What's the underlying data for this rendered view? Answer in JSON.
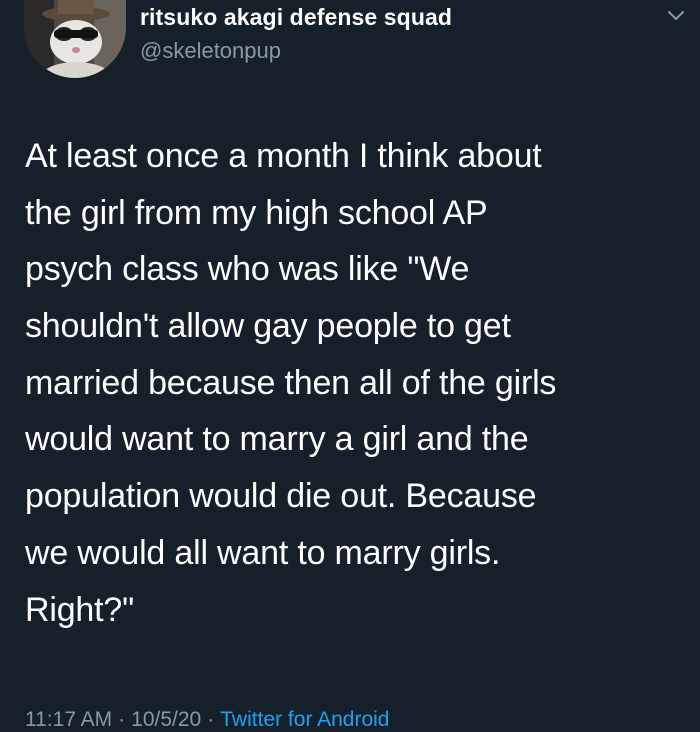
{
  "tweet": {
    "display_name": "ritsuko akagi defense squad",
    "handle": "@skeletonpup",
    "body_lines": [
      "At least once a month I think about",
      "the girl from my high school AP",
      "psych class who was like \"We",
      "shouldn't allow gay people to get",
      "married because then all of the girls",
      "would want to marry a girl and the",
      "population would die out. Because",
      "we would all want to marry girls.",
      "Right?\""
    ],
    "time": "11:17 AM",
    "separator": "·",
    "date": "10/5/20",
    "source": "Twitter for Android"
  },
  "icons": {
    "menu": "chevron-down-icon",
    "avatar": "cat-avatar"
  },
  "colors": {
    "background": "#15202b",
    "secondary_text": "#8899a6",
    "link": "#1da1f2"
  }
}
